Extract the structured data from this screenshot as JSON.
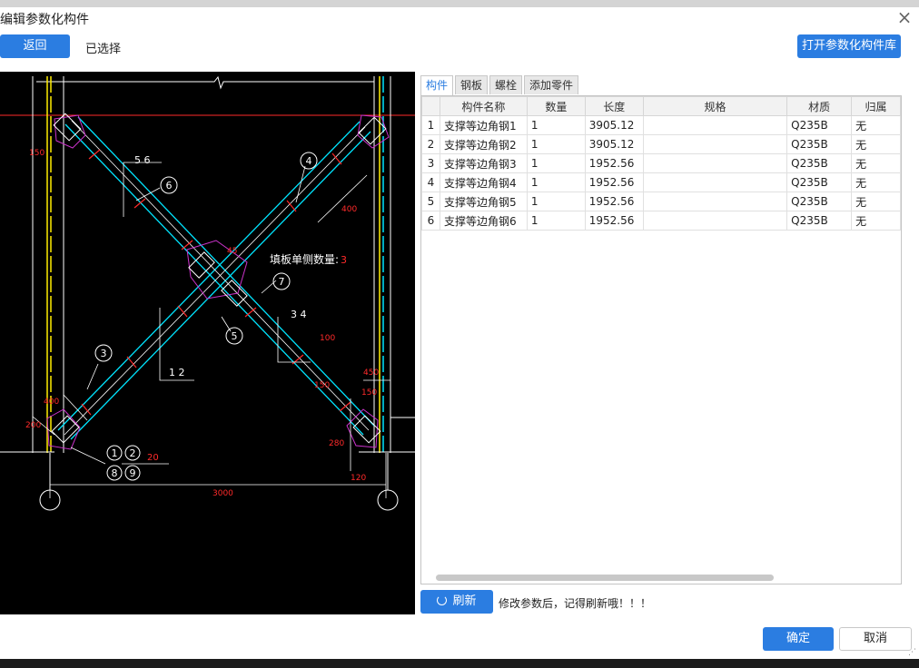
{
  "dialog": {
    "title": "编辑参数化构件",
    "close_icon": "close-icon",
    "back_label": "返回",
    "selected_label": "已选择",
    "open_library_label": "打开参数化构件库"
  },
  "drawing": {
    "fill_label": "填板单侧数量:",
    "fill_count": "3",
    "dims": {
      "d150_top": "150",
      "d56": "5 6",
      "d400_right": "400",
      "d45": "45",
      "d34": "3 4",
      "d100_right": "100",
      "d12": "1 2",
      "d150_lower": "150",
      "d400_left": "400",
      "d200": "200",
      "d450": "450",
      "d150_right": "150",
      "d280": "280",
      "d120": "120",
      "d20": "20",
      "d3000": "3000"
    },
    "callouts": [
      "1",
      "2",
      "3",
      "4",
      "5",
      "6",
      "7",
      "8",
      "9"
    ]
  },
  "tabs": [
    {
      "label": "构件",
      "active": true
    },
    {
      "label": "钢板",
      "active": false
    },
    {
      "label": "螺栓",
      "active": false
    },
    {
      "label": "添加零件",
      "active": false
    }
  ],
  "table": {
    "headers": [
      "",
      "构件名称",
      "数量",
      "长度",
      "规格",
      "材质",
      "归属"
    ],
    "rows": [
      [
        "1",
        "支撑等边角钢1",
        "1",
        "3905.12",
        "",
        "Q235B",
        "无"
      ],
      [
        "2",
        "支撑等边角钢2",
        "1",
        "3905.12",
        "",
        "Q235B",
        "无"
      ],
      [
        "3",
        "支撑等边角钢3",
        "1",
        "1952.56",
        "",
        "Q235B",
        "无"
      ],
      [
        "4",
        "支撑等边角钢4",
        "1",
        "1952.56",
        "",
        "Q235B",
        "无"
      ],
      [
        "5",
        "支撑等边角钢5",
        "1",
        "1952.56",
        "",
        "Q235B",
        "无"
      ],
      [
        "6",
        "支撑等边角钢6",
        "1",
        "1952.56",
        "",
        "Q235B",
        "无"
      ]
    ]
  },
  "footer": {
    "refresh_label": "刷新",
    "hint": "修改参数后，记得刷新哦！！！",
    "ok_label": "确定",
    "cancel_label": "取消"
  },
  "colors": {
    "accent": "#2b7de1",
    "cad_background": "#000000",
    "cad_dimension": "#ff2a2a",
    "cad_member": "#00e5ff",
    "cad_plate": "#cc33cc",
    "cad_column": "#ffee00"
  }
}
